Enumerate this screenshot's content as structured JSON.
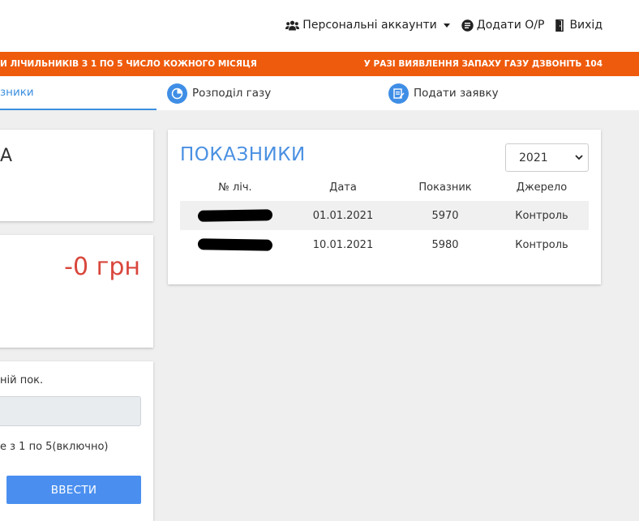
{
  "header": {
    "accounts_label": "Персональні аккаунти",
    "add_label": "Додати О/Р",
    "logout_label": "Вихід"
  },
  "banner": {
    "left_text": "И ЛІЧИЛЬНИКІВ З 1 ПО 5 ЧИСЛО КОЖНОГО МІСЯЦЯ",
    "right_text": "У РАЗІ ВИЯВЛЕННЯ ЗАПАХУ ГАЗУ ДЗВОНІТЬ 104"
  },
  "tabs": [
    {
      "label": "зники"
    },
    {
      "label": "Розподіл газу"
    },
    {
      "label": "Подати заявку"
    }
  ],
  "left_cards": {
    "name_fragment": "А",
    "balance": "-0 грн",
    "form": {
      "label": "ній пок.",
      "hint": "е з 1 по 5(включно)",
      "submit_label": "ВВЕСТИ"
    }
  },
  "readings": {
    "title": "ПОКАЗНИКИ",
    "year": "2021",
    "columns": [
      "№ ліч.",
      "Дата",
      "Показник",
      "Джерело"
    ],
    "rows": [
      {
        "date": "01.01.2021",
        "value": "5970",
        "source": "Контроль"
      },
      {
        "date": "10.01.2021",
        "value": "5980",
        "source": "Контроль"
      }
    ]
  },
  "colors": {
    "accent": "#3c8fe0",
    "banner": "#ef5b0c",
    "balance": "#d9463c",
    "button": "#4a8ff0"
  }
}
